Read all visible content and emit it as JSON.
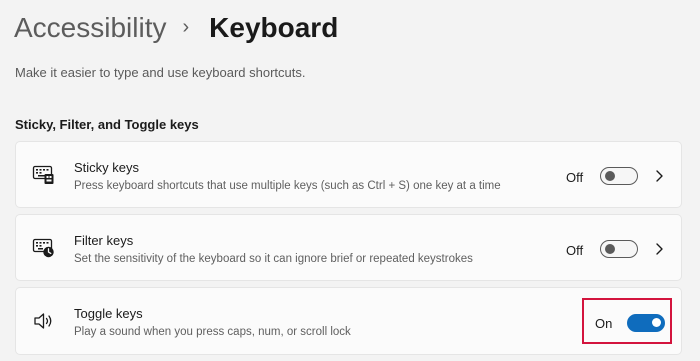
{
  "breadcrumb": {
    "parent": "Accessibility",
    "separator": "›",
    "current": "Keyboard"
  },
  "subtitle": "Make it easier to type and use keyboard shortcuts.",
  "section_title": "Sticky, Filter, and Toggle keys",
  "settings": [
    {
      "title": "Sticky keys",
      "description": "Press keyboard shortcuts that use multiple keys (such as Ctrl + S) one key at a time",
      "state_label": "Off",
      "enabled": false,
      "icon": "keyboard-sticky-icon",
      "has_chevron": true
    },
    {
      "title": "Filter keys",
      "description": "Set the sensitivity of the keyboard so it can ignore brief or repeated keystrokes",
      "state_label": "Off",
      "enabled": false,
      "icon": "keyboard-filter-icon",
      "has_chevron": true
    },
    {
      "title": "Toggle keys",
      "description": "Play a sound when you press caps, num, or scroll lock",
      "state_label": "On",
      "enabled": true,
      "icon": "speaker-icon",
      "has_chevron": false
    }
  ],
  "colors": {
    "accent": "#0f6cbd",
    "highlight_border": "#d3143d",
    "card_background": "#fbfbfb",
    "page_background": "#f3f3f3"
  }
}
